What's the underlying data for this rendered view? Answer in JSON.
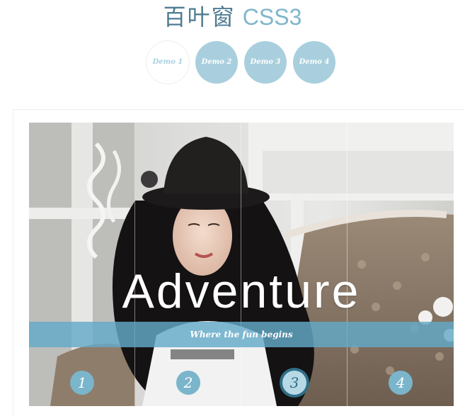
{
  "header": {
    "title_cn": "百叶窗",
    "title_en": "CSS3"
  },
  "demo_nav": {
    "items": [
      {
        "label": "Demo 1",
        "active": true
      },
      {
        "label": "Demo 2",
        "active": false
      },
      {
        "label": "Demo 3",
        "active": false
      },
      {
        "label": "Demo 4",
        "active": false
      }
    ]
  },
  "slide": {
    "headline": "Adventure",
    "tagline": "Where the fun begins",
    "pager": [
      "1",
      "2",
      "3",
      "4"
    ],
    "active_page": 3
  },
  "colors": {
    "accent": "#a9cfde",
    "pager_active_ring": "#2f6f87",
    "tagline_bar": "#64aac8"
  }
}
